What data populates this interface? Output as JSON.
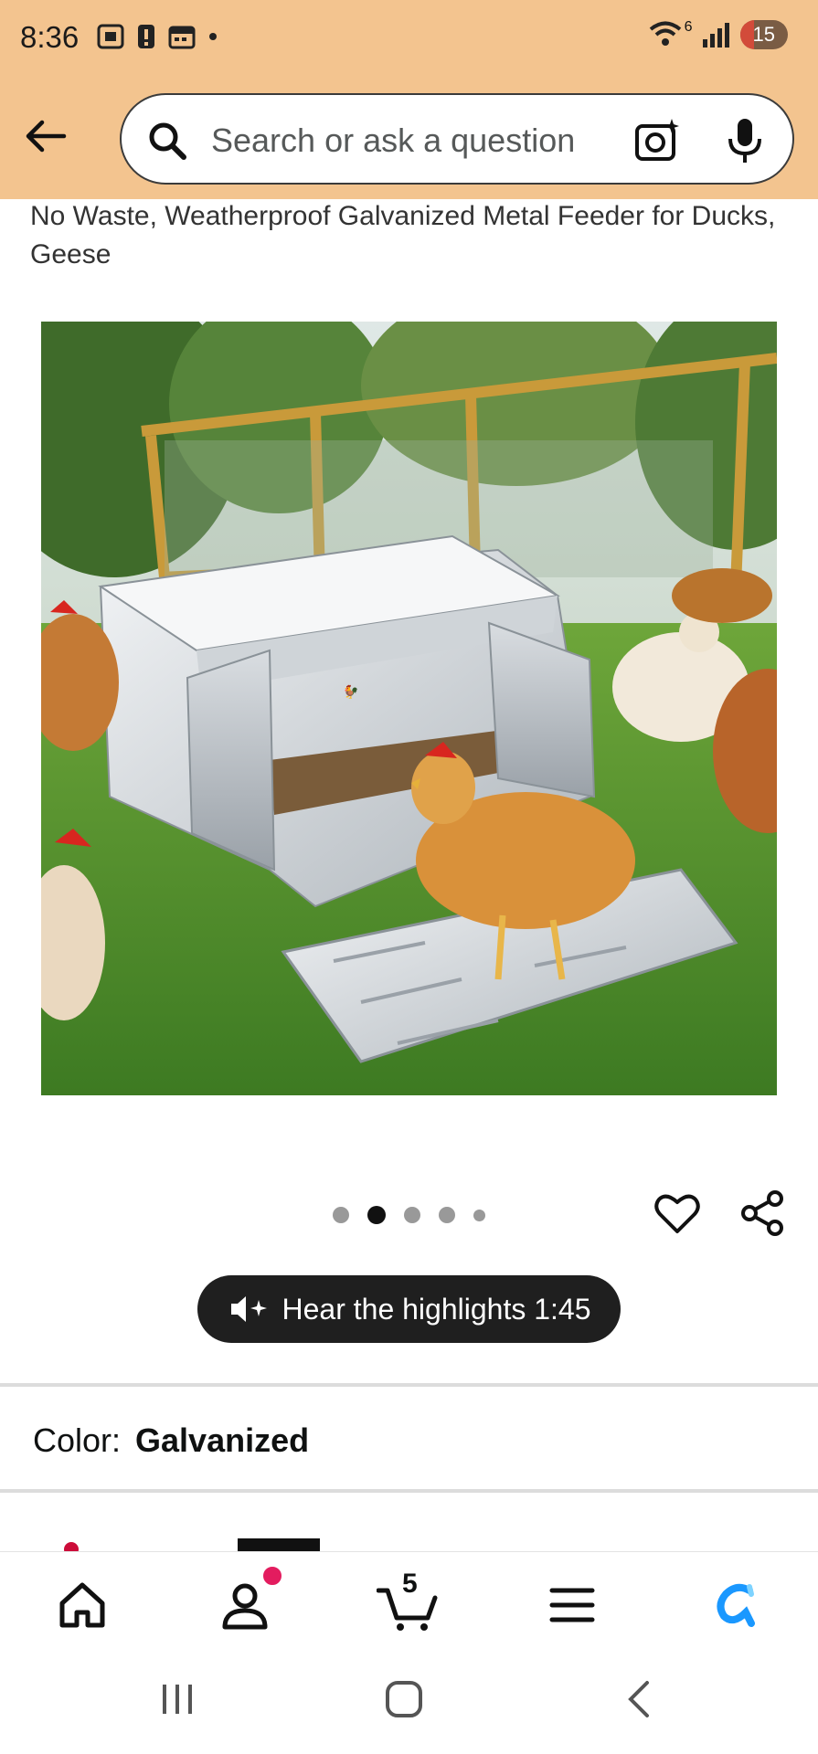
{
  "status_bar": {
    "time": "8:36",
    "network": "6",
    "battery": "15"
  },
  "search": {
    "placeholder": "Search or ask a question"
  },
  "product": {
    "title": "No Waste, Weatherproof Galvanized Metal Feeder for Ducks, Geese",
    "image_alt": "Galvanized treadle chicken feeder with chickens in a garden",
    "image_count": 5,
    "active_image_index": 2
  },
  "highlights": {
    "label": "Hear the highlights 1:45"
  },
  "options": {
    "color_label": "Color:",
    "color_value": "Galvanized"
  },
  "bottom_nav": {
    "cart_count": "5"
  },
  "colors": {
    "header_bg": "#f3c48f",
    "accent_blue": "#1a98ff",
    "notif_pink": "#e31c5f"
  }
}
